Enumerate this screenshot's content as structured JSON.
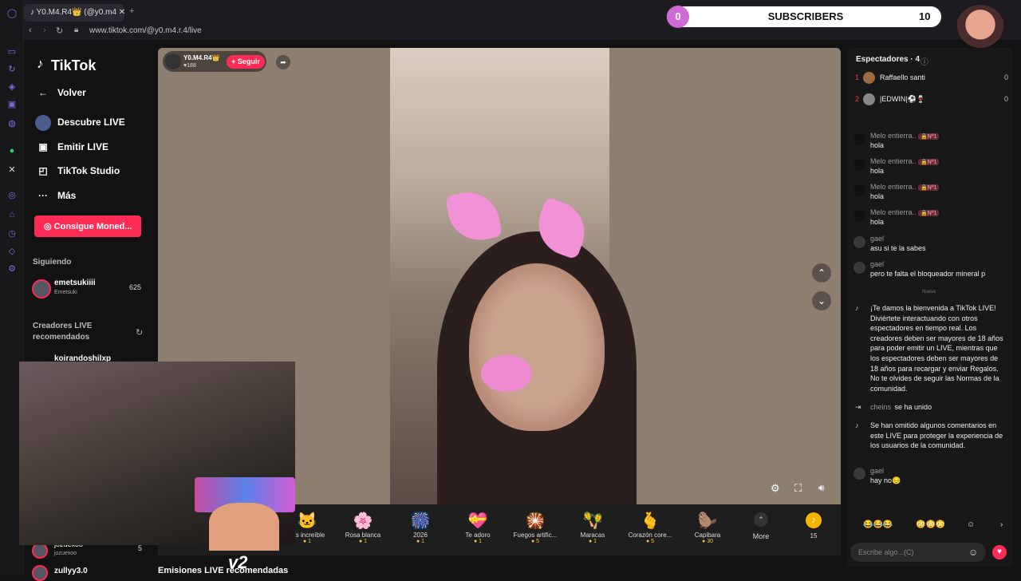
{
  "browser": {
    "tab_title": "Y0.M4.R4👑 (@y0.m4",
    "url": "www.tiktok.com/@y0.m4.r.4/live"
  },
  "overlay": {
    "subscribers_left": "0",
    "subscribers_label": "SUBSCRIBERS",
    "subscribers_right": "10",
    "webcam_watermark": "v2"
  },
  "sidebar": {
    "logo": "TikTok",
    "back": "Volver",
    "items": [
      {
        "label": "Descubre LIVE",
        "icon": "live-discover-icon"
      },
      {
        "label": "Emitir LIVE",
        "icon": "camera-icon"
      },
      {
        "label": "TikTok Studio",
        "icon": "studio-icon"
      },
      {
        "label": "Más",
        "icon": "more-icon"
      }
    ],
    "coins_button": "Consigue Moned...",
    "following_title": "Siguiendo",
    "following": [
      {
        "name": "emetsukiiii",
        "sub": "Emetsuki",
        "count": "625"
      }
    ],
    "recommended_title": "Creadores LIVE recomendados",
    "recommended": [
      {
        "name": "koirandoshilxp"
      },
      {
        "name": "jozuexoo",
        "sub": "jozuexoo",
        "count": "5"
      },
      {
        "name": "zullyy3.0"
      }
    ]
  },
  "stream": {
    "host_name": "Y0.M4.R4👑",
    "host_likes": "♥188",
    "follow_label": "+ Seguir",
    "bottom_text": "Emisiones LIVE recomendadas"
  },
  "gifts": [
    {
      "name": "¡Es increíble",
      "cost": "1",
      "icon": "🐱"
    },
    {
      "name": "Rosa blanca",
      "cost": "1",
      "icon": "🌸"
    },
    {
      "name": "2026",
      "cost": "1",
      "icon": "🎆"
    },
    {
      "name": "Te adoro",
      "cost": "1",
      "icon": "💝"
    },
    {
      "name": "Fuegos artific...",
      "cost": "5",
      "icon": "🎇"
    },
    {
      "name": "Maracas",
      "cost": "1",
      "icon": "🪇"
    },
    {
      "name": "Corazón core...",
      "cost": "5",
      "icon": "🫰"
    },
    {
      "name": "Capibara",
      "cost": "30",
      "icon": "🦫"
    }
  ],
  "gift_more_label": "More",
  "gift_coins": "15",
  "panel": {
    "spectators_label": "Espectadores · 4",
    "spectators": [
      {
        "rank": "1",
        "name": "Raffaello santi",
        "score": "0"
      },
      {
        "rank": "2",
        "name": "|EDWIN|⚽🍷",
        "score": "0"
      }
    ],
    "chat": [
      {
        "name": "Melo entierra..",
        "badge": "🔒Nº1",
        "msg": "hola"
      },
      {
        "name": "Melo entierra..",
        "badge": "🔒Nº1",
        "msg": "hola"
      },
      {
        "name": "Melo entierra..",
        "badge": "🔒Nº1",
        "msg": "hola"
      },
      {
        "name": "Melo entierra..",
        "badge": "🔒Nº1",
        "msg": "hola"
      },
      {
        "name": "gael",
        "badge": "",
        "msg": "asu si te la sabes"
      },
      {
        "name": "gael",
        "badge": "",
        "msg": "pero te falta el bloqueador mineral p"
      }
    ],
    "new_divider": "Nuevo",
    "welcome": "¡Te damos la bienvenida a TikTok LIVE! Diviértete interactuando con otros espectadores en tiempo real. Los creadores deben ser mayores de 18 años para poder emitir un LIVE, mientras que los espectadores deben ser mayores de 18 años para recargar y enviar Regalos. No te olvides de seguir las Normas de la comunidad.",
    "joined_name": "cheins",
    "joined_text": "se ha unido",
    "omitted": "Se han omitido algunos comentarios en este LIVE para proteger la experiencia de los usuarios de la comunidad.",
    "last_name": "gael",
    "last_msg": "hay no😔",
    "quick_reactions": "😂😂😂",
    "quick_emojis": "😳😳😳",
    "input_placeholder": "Escribe algo...(C)"
  }
}
